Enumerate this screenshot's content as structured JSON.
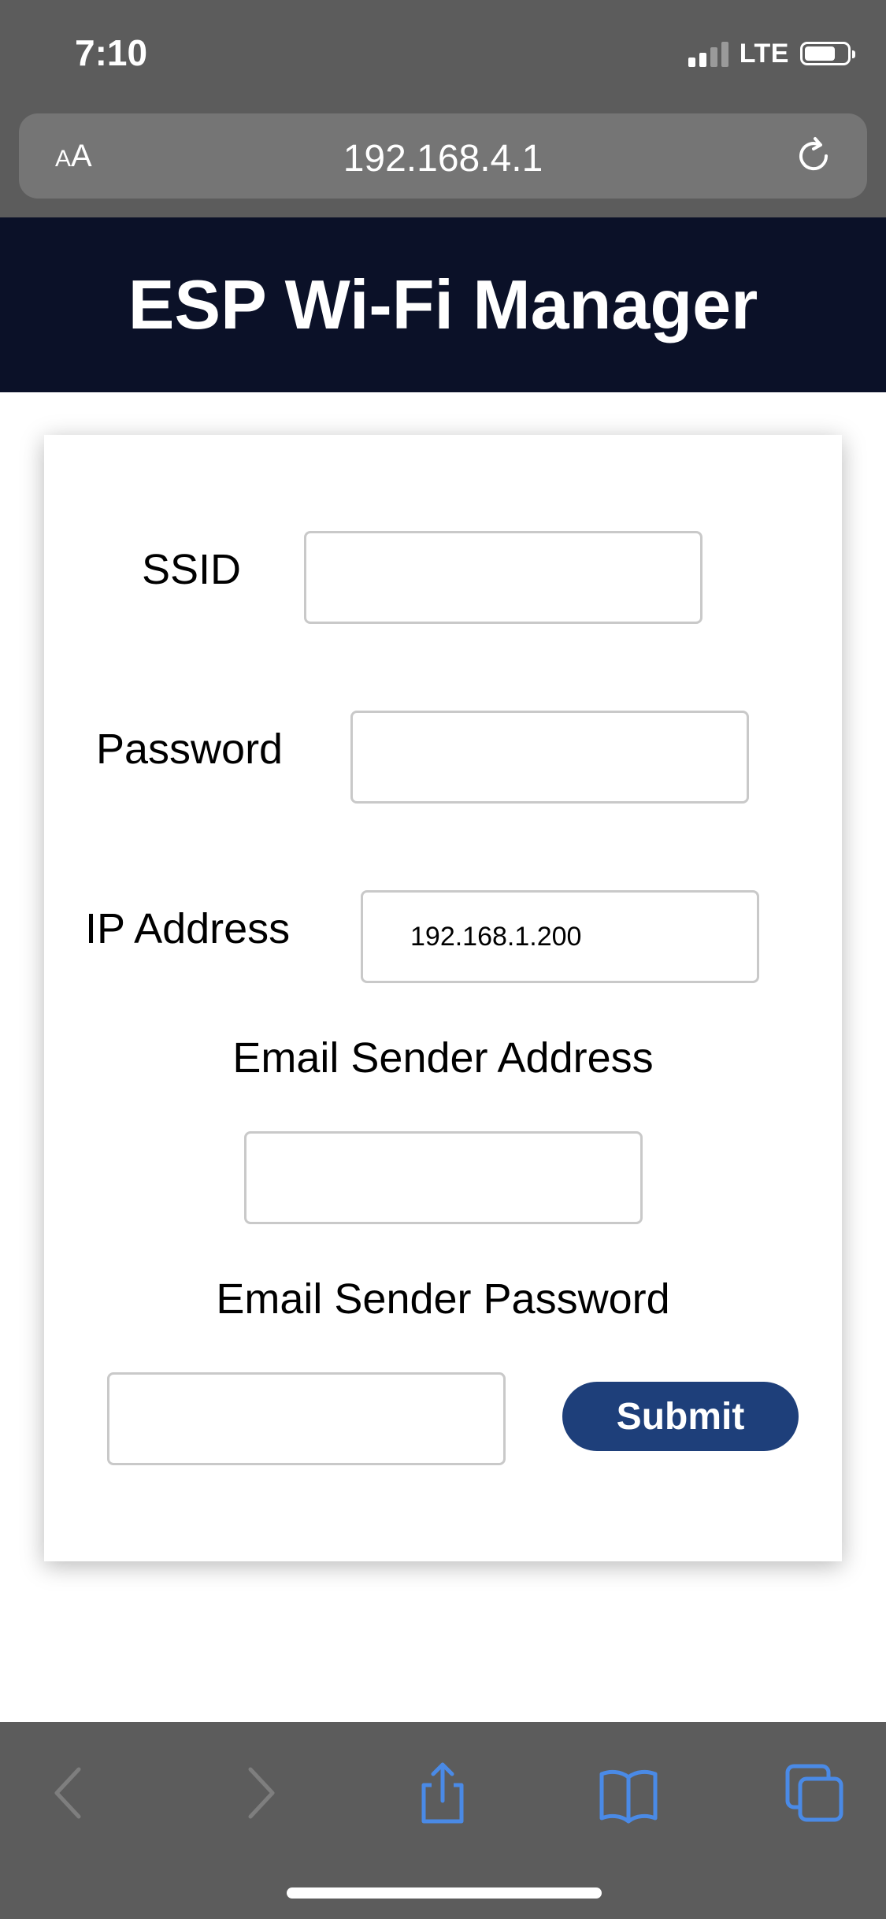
{
  "status_bar": {
    "time": "7:10",
    "network": "LTE"
  },
  "browser": {
    "text_size_label": "AA",
    "url": "192.168.4.1"
  },
  "page": {
    "title": "ESP Wi-Fi Manager",
    "form": {
      "ssid_label": "SSID",
      "ssid_value": "",
      "password_label": "Password",
      "password_value": "",
      "ip_label": "IP Address",
      "ip_value": "192.168.1.200",
      "email_sender_address_label": "Email Sender Address",
      "email_sender_address_value": "",
      "email_sender_password_label": "Email Sender Password",
      "email_sender_password_value": "",
      "submit_label": "Submit"
    }
  },
  "toolbar": {
    "icons": [
      "back-icon",
      "forward-icon",
      "share-icon",
      "bookmarks-icon",
      "tabs-icon"
    ]
  },
  "colors": {
    "header_bg": "#0b1128",
    "submit_bg": "#1e3f7a",
    "chrome_bg": "#5c5c5c",
    "toolbar_icon_active": "#4a8ae6",
    "toolbar_icon_disabled": "#7e7e7e"
  }
}
